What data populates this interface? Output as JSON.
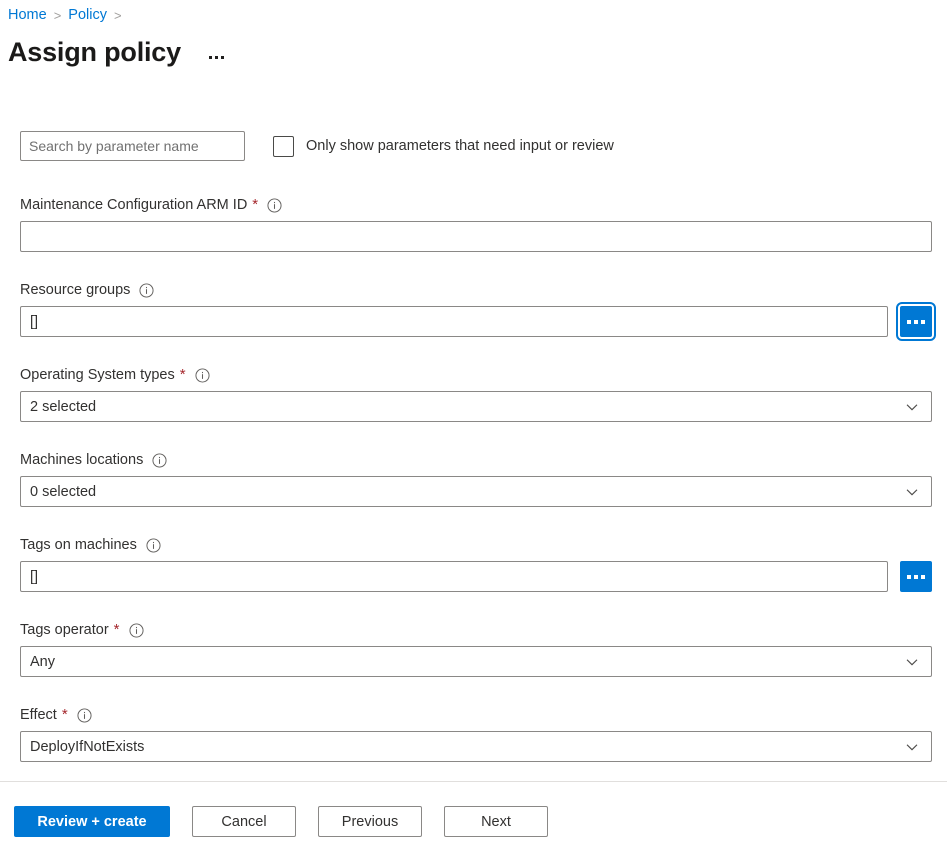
{
  "breadcrumb": {
    "items": [
      {
        "label": "Home"
      },
      {
        "label": "Policy"
      }
    ],
    "separator": ">"
  },
  "header": {
    "title": "Assign policy",
    "more_actions": "..."
  },
  "filters": {
    "search_placeholder": "Search by parameter name",
    "search_value": "",
    "checkbox_label": "Only show parameters that need input or review",
    "checkbox_checked": false
  },
  "fields": [
    {
      "label": "Maintenance Configuration ARM ID",
      "required": true,
      "info": "info-icon",
      "control": "text",
      "value": "",
      "has_picker": false
    },
    {
      "label": "Resource groups",
      "required": false,
      "info": "info-icon",
      "control": "text",
      "value": "[]",
      "has_picker": true,
      "picker_label": "...",
      "picker_focused": true
    },
    {
      "label": "Operating System types",
      "required": true,
      "info": "info-icon",
      "control": "select",
      "value": "2 selected",
      "has_picker": false
    },
    {
      "label": "Machines locations",
      "required": false,
      "info": "info-icon",
      "control": "select",
      "value": "0 selected",
      "has_picker": false
    },
    {
      "label": "Tags on machines",
      "required": false,
      "info": "info-icon",
      "control": "text",
      "value": "[]",
      "has_picker": true,
      "picker_label": "...",
      "picker_focused": false
    },
    {
      "label": "Tags operator",
      "required": true,
      "info": "info-icon",
      "control": "select",
      "value": "Any",
      "has_picker": false
    },
    {
      "label": "Effect",
      "required": true,
      "info": "info-icon",
      "control": "select",
      "value": "DeployIfNotExists",
      "has_picker": false
    }
  ],
  "footer": {
    "buttons": [
      {
        "label": "Review + create",
        "kind": "primary"
      },
      {
        "label": "Cancel",
        "kind": "secondary"
      },
      {
        "label": "Previous",
        "kind": "secondary"
      },
      {
        "label": "Next",
        "kind": "secondary"
      }
    ]
  },
  "colors": {
    "accent": "#0078d4",
    "link": "#0078d4",
    "required_asterisk": "#a4262c",
    "border": "#8a8886",
    "text": "#323130",
    "divider": "#e1dfdd"
  }
}
